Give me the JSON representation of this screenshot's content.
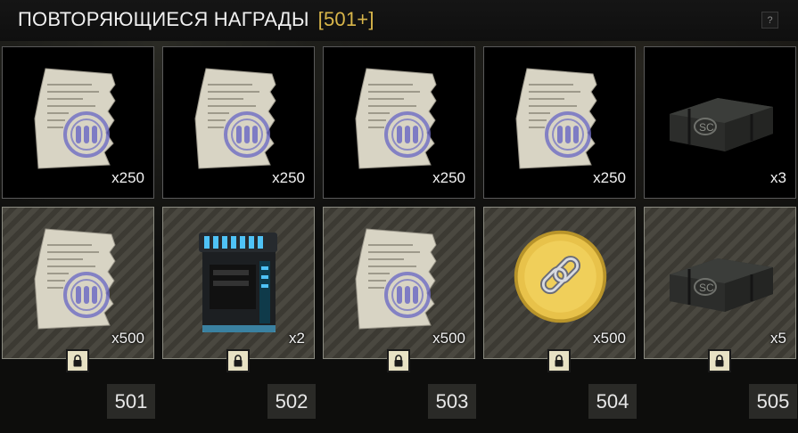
{
  "header": {
    "title": "ПОВТОРЯЮЩИЕСЯ НАГРАДЫ",
    "count": "[501+]",
    "help": "?"
  },
  "colors": {
    "accent": "#d9b64a",
    "tile_bg": "#000000",
    "locked_stripe": "#4a4840",
    "lock_badge": "#e8e2c4"
  },
  "rewards_row1": [
    {
      "icon": "ammo-voucher-icon",
      "qty": "x250"
    },
    {
      "icon": "ammo-voucher-icon",
      "qty": "x250"
    },
    {
      "icon": "ammo-voucher-icon",
      "qty": "x250"
    },
    {
      "icon": "ammo-voucher-icon",
      "qty": "x250"
    },
    {
      "icon": "sc-crate-icon",
      "qty": "x3"
    }
  ],
  "rewards_row2": [
    {
      "icon": "ammo-voucher-icon",
      "qty": "x500",
      "locked": true
    },
    {
      "icon": "battery-container-icon",
      "qty": "x2",
      "locked": true
    },
    {
      "icon": "ammo-voucher-icon",
      "qty": "x500",
      "locked": true
    },
    {
      "icon": "gold-link-coin-icon",
      "qty": "x500",
      "locked": true
    },
    {
      "icon": "sc-crate-icon",
      "qty": "x5",
      "locked": true
    }
  ],
  "levels": [
    "501",
    "502",
    "503",
    "504",
    "505"
  ]
}
